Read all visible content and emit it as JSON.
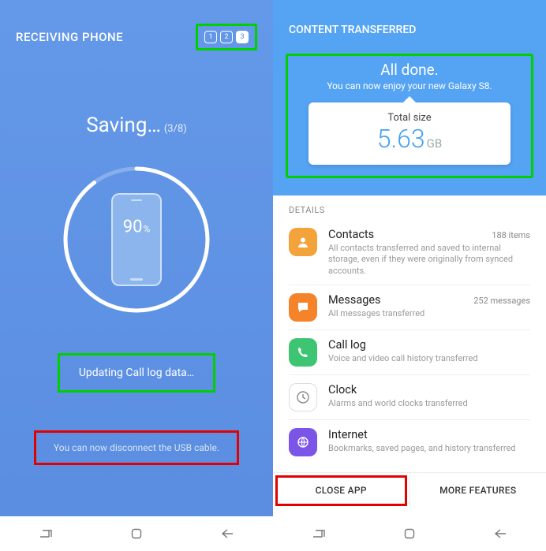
{
  "left": {
    "header_title": "RECEIVING PHONE",
    "steps": [
      "1",
      "2",
      "3"
    ],
    "saving_label": "Saving…",
    "saving_count": "(3/8)",
    "percent_value": "90",
    "percent_symbol": "%",
    "status_message": "Updating Call log data…",
    "usb_message": "You can now disconnect the USB cable."
  },
  "right": {
    "header_title": "CONTENT TRANSFERRED",
    "done_title": "All done.",
    "done_sub": "You can now enjoy your new Galaxy S8.",
    "size_label": "Total size",
    "size_value": "5.63",
    "size_unit": "GB",
    "details_label": "DETAILS",
    "items": [
      {
        "title": "Contacts",
        "count": "188 items",
        "desc": "All contacts transferred and saved to internal storage, even if they were originally from synced accounts."
      },
      {
        "title": "Messages",
        "count": "252 messages",
        "desc": "All messages transferred"
      },
      {
        "title": "Call log",
        "count": "",
        "desc": "Voice and video call history transferred"
      },
      {
        "title": "Clock",
        "count": "",
        "desc": "Alarms and world clocks transferred"
      },
      {
        "title": "Internet",
        "count": "",
        "desc": "Bookmarks, saved pages, and history transferred"
      }
    ],
    "close_label": "CLOSE APP",
    "more_label": "MORE FEATURES"
  }
}
